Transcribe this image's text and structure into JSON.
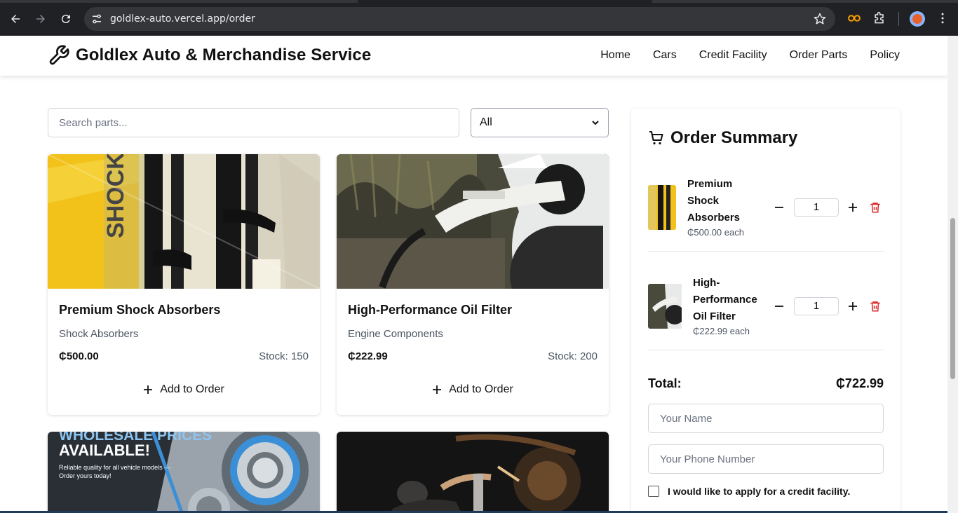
{
  "browser": {
    "url": "goldlex-auto.vercel.app/order"
  },
  "header": {
    "brand": "Goldlex Auto & Merchandise Service",
    "nav": [
      "Home",
      "Cars",
      "Credit Facility",
      "Order Parts",
      "Policy"
    ]
  },
  "filters": {
    "search_placeholder": "Search parts...",
    "category_selected": "All"
  },
  "products": [
    {
      "name": "Premium Shock Absorbers",
      "category": "Shock Absorbers",
      "price": "₵500.00",
      "stock": "Stock: 150",
      "add_label": "Add to Order"
    },
    {
      "name": "High-Performance Oil Filter",
      "category": "Engine Components",
      "price": "₵222.99",
      "stock": "Stock: 200",
      "add_label": "Add to Order"
    },
    {
      "banner_line1": "WHOLESALE PRICES",
      "banner_line2": "AVAILABLE!",
      "banner_line3": "Reliable quality for all vehicle models —",
      "banner_line4": "Order yours today!"
    },
    {}
  ],
  "summary": {
    "title": "Order Summary",
    "items": [
      {
        "name_lines": [
          "Premium",
          "Shock",
          "Absorbers"
        ],
        "each": "₵500.00 each",
        "qty": "1"
      },
      {
        "name_lines": [
          "High-",
          "Performance",
          "Oil Filter"
        ],
        "each": "₵222.99 each",
        "qty": "1"
      }
    ],
    "total_label": "Total:",
    "total_value": "₵722.99",
    "name_placeholder": "Your Name",
    "phone_placeholder": "Your Phone Number",
    "credit_label": "I would like to apply for a credit facility."
  },
  "colors": {
    "chrome_bg": "#202124",
    "trash_red": "#dc2626",
    "shock_yellow": "#f2c21b"
  }
}
